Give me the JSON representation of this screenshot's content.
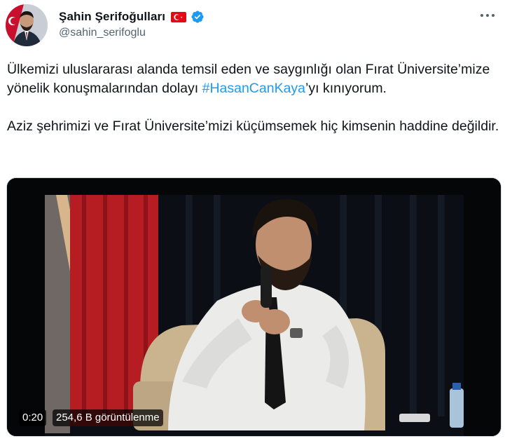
{
  "author": {
    "display_name": "Şahin Şerifoğulları",
    "handle": "@sahin_serifoglu",
    "flag_icon": "turkey-flag-icon",
    "verified_icon": "verified-badge-icon",
    "avatar_icon": "profile-avatar"
  },
  "tweet": {
    "paragraph1_before": "Ülkemizi uluslararası alanda temsil eden ve saygınlığı olan Fırat Üniversite’mize yönelik konuşmalarından dolayı ",
    "hashtag": "#HasanCanKaya",
    "paragraph1_after": "’yı kınıyorum.",
    "paragraph2": "Aziz şehrimizi ve Fırat Üniversite’mizi küçümsemek hiç kimsenin haddine değildir."
  },
  "video": {
    "duration": "0:20",
    "views": "254,6 B görüntülenme"
  },
  "colors": {
    "link": "#1d9bf0",
    "verified": "#1d9bf0",
    "flag_red": "#e30a17",
    "secondary_text": "#536471"
  }
}
